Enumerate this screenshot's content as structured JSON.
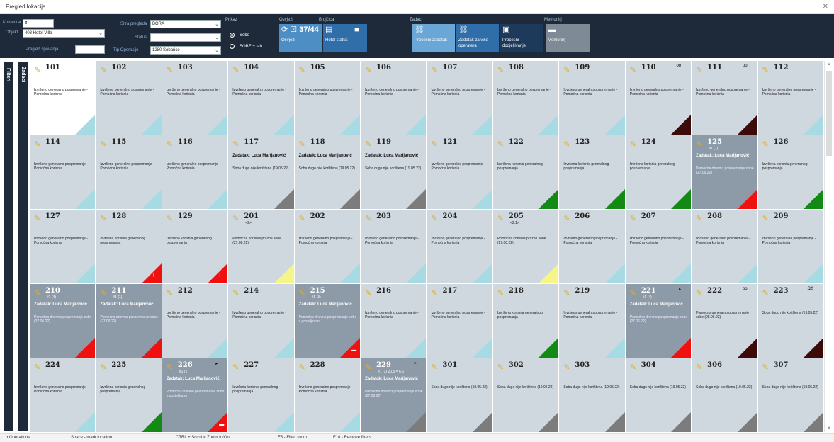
{
  "window": {
    "title": "Pregled lokacija",
    "close_glyph": "✕"
  },
  "toolbar": {
    "fields": {
      "komentar_label": "Komentar",
      "komentar_value": "ff",
      "objekt_label": "Objekt",
      "objekt_value": "408 Hotel Villa",
      "pregled_spavanja_label": "Pregled spavanja",
      "pregled_spavanja_value": "",
      "pregled_label": "Šifra pregleda",
      "pregled_value": "BORA",
      "status_label": "Status",
      "status_value": "",
      "tip_operacije_label": "Tip Operacije",
      "tip_operacije_value": "1280 Sobarice"
    },
    "prikaz": {
      "label": "Prikaz",
      "option1": "Sobe",
      "option2": "SOBE + tab."
    },
    "groups": {
      "osvjezi": "Osvježi",
      "brojcica": "Brojčica",
      "zadaci": "Zadaci",
      "mentalni": "Memonirj"
    },
    "buttons": {
      "osvjezi": "Osvježi",
      "counter": "37/44",
      "hotel_status": "Hotel status",
      "procesni_zadaci": "Procesni zadatak",
      "zadatak_za_vise": "Zadatak za više operatera",
      "procesni_dodjeljivanje": "Procesni dodjeljivanje",
      "memonirj": "Memonirj"
    }
  },
  "sidebar": {
    "label1": "Zadaci",
    "label2": "Filteri"
  },
  "colors": {
    "green": "#138a13",
    "red": "#f01010",
    "dark_red": "#3d0a0a",
    "grey": "#7c7c7c",
    "light_blue": "#a6dbe3",
    "yellow": "#f5f58a",
    "occupied": "#8d9aa7",
    "toolbar_bg": "#1e2a3a"
  },
  "rooms": [
    {
      "num": "101",
      "desc": "Izvršeno generalno pospremanje - Pomoćna korisnia",
      "tri": "#a6dbe3",
      "bg": "white"
    },
    {
      "num": "102",
      "desc": "Izvršeno generalno pospremanje - Pomoćna korisnia",
      "tri": "#a6dbe3"
    },
    {
      "num": "103",
      "desc": "Izvršeno generalno pospremanje - Pomoćna korisnia",
      "tri": "#a6dbe3"
    },
    {
      "num": "104",
      "desc": "Izvršeno generalno pospremanje - Pomoćna korisnia",
      "tri": "#a6dbe3"
    },
    {
      "num": "105",
      "desc": "Izvršeno generalno pospremanje - Pomoćna korisnia",
      "tri": "#a6dbe3"
    },
    {
      "num": "106",
      "desc": "Izvršeno generalno pospremanje - Pomoćna korisnia",
      "tri": "#a6dbe3"
    },
    {
      "num": "107",
      "desc": "Izvršeno generalno pospremanje - Pomoćna korisnia",
      "tri": "#a6dbe3"
    },
    {
      "num": "108",
      "desc": "Izvršeno generalno pospremanje - Pomoćna korisnia",
      "tri": "#a6dbe3"
    },
    {
      "num": "109",
      "desc": "Izvršeno generalno pospremanje - Pomoćna korisnia",
      "tri": "#a6dbe3"
    },
    {
      "num": "110",
      "gl": "oo",
      "desc": "Izvršeno generalno pospremanje - Pomoćna korisnia",
      "tri": "#3d0a0a"
    },
    {
      "num": "111",
      "gl": "oo",
      "desc": "Izvršeno generalno pospremanje - Pomoćna korisnia",
      "tri": "#3d0a0a"
    },
    {
      "num": "112",
      "desc": "Izvršeno generalno pospremanje - Pomoćna korisnia",
      "tri": "#a6dbe3"
    },
    {
      "num": "114",
      "desc": "Izvršeno generalno pospremanje - Pomoćna korisnia",
      "tri": "#a6dbe3"
    },
    {
      "num": "115",
      "desc": "Izvršeno generalno pospremanje - Pomoćna korisnia",
      "tri": "#a6dbe3"
    },
    {
      "num": "116",
      "desc": "Izvršeno generalno pospremanje - Pomoćna korisnia",
      "tri": "#a6dbe3"
    },
    {
      "num": "117",
      "bold": "Zadatak: Luca Marijanović",
      "desc": "Soba dugo nije korištena (19.05.22)",
      "tri": "#7c7c7c"
    },
    {
      "num": "118",
      "bold": "Zadatak: Luca Marijanović",
      "desc": "Soba dugo nije korištena (19.05.22)",
      "tri": "#7c7c7c"
    },
    {
      "num": "119",
      "bold": "Zadatak: Luca Marijanović",
      "desc": "Soba dugo nije korištena (19.05.22)",
      "tri": "#7c7c7c"
    },
    {
      "num": "121",
      "desc": "Izvršeno generalno pospremanje - Pomoćna korisnia",
      "tri": "#a6dbe3"
    },
    {
      "num": "122",
      "desc": "Izvršena korisnia generalnog pospremanja",
      "tri": "#138a13"
    },
    {
      "num": "123",
      "desc": "Izvršena korisnia generalnog pospremanja",
      "tri": "#138a13"
    },
    {
      "num": "124",
      "desc": "Izvršena korisnia generalnog pospremanja",
      "tri": "#138a13"
    },
    {
      "num": "125",
      "sub": "#1 (1)",
      "bold": "Zadatak: Luca Marijanović",
      "desc": "Pomoćna dnevno pospremanje sobe (27.06.22)",
      "tri": "#f01010",
      "bg": "occ"
    },
    {
      "num": "126",
      "desc": "Izvršena korisnia generalnog pospremanja",
      "tri": "#138a13"
    },
    {
      "num": "127",
      "desc": "Izvršeno generalno pospremanje - Pomoćna korisnia",
      "tri": "#a6dbe3"
    },
    {
      "num": "128",
      "desc": "Izvršena korisnia generalnog pospremanja",
      "tri": "#f01010",
      "mark": "!"
    },
    {
      "num": "129",
      "desc": "Izvršena korisnia generalnog pospremanja",
      "tri": "#f01010",
      "mark": "!"
    },
    {
      "num": "201",
      "sub": "<2>",
      "desc": "Pomoćna korisnia prazne sobe (27.06.22)",
      "tri": "#f5f58a"
    },
    {
      "num": "202",
      "desc": "Izvršeno generalno pospremanje - Pomoćna korisnia",
      "tri": "#a6dbe3"
    },
    {
      "num": "203",
      "desc": "Izvršeno generalno pospremanje - Pomoćna korisnia",
      "tri": "#a6dbe3"
    },
    {
      "num": "204",
      "desc": "Izvršeno generalno pospremanje - Pomoćna korisnia",
      "tri": "#a6dbe3"
    },
    {
      "num": "205",
      "sub": "<2.1>",
      "desc": "Pomoćna korisnia prazne sobe (27.06.22)",
      "tri": "#f5f58a"
    },
    {
      "num": "206",
      "desc": "Izvršeno generalno pospremanje - Pomoćna korisnia",
      "tri": "#a6dbe3"
    },
    {
      "num": "207",
      "desc": "Izvršeno generalno pospremanje - Pomoćna korisnia",
      "tri": "#a6dbe3"
    },
    {
      "num": "208",
      "desc": "Izvršeno generalno pospremanje - Pomoćna korisnia",
      "tri": "#a6dbe3"
    },
    {
      "num": "209",
      "desc": "Izvršeno generalno pospremanje - Pomoćna korisnia",
      "tri": "#a6dbe3"
    },
    {
      "num": "210",
      "sub": "#1 (4)",
      "bold": "Zadatak: Luca Marijanović",
      "desc": "Pomoćna dnevno pospremanje sobe (27.06.22)",
      "tri": "#f01010",
      "bg": "occ"
    },
    {
      "num": "211",
      "sub": "#1 (1)",
      "bold": "Zadatak: Luca Marijanović",
      "desc": "Pomoćna dnevno pospremanje sobe (27.06.22)",
      "tri": "#f01010",
      "bg": "occ"
    },
    {
      "num": "212",
      "desc": "Izvršeno generalno pospremanje - Pomoćna korisnia",
      "tri": "#a6dbe3"
    },
    {
      "num": "214",
      "desc": "Izvršeno generalno pospremanje - Pomoćna korisnia",
      "tri": "#a6dbe3"
    },
    {
      "num": "215",
      "sub": "#1 (3)",
      "bold": "Zadatak: Luca Marijanović",
      "desc": "Pomoćna dnevno pospremanje sobe s posteljinom",
      "tri": "#f01010",
      "bg": "occ",
      "mark": "▬"
    },
    {
      "num": "216",
      "desc": "Izvršeno generalno pospremanje - Pomoćna korisnia",
      "tri": "#a6dbe3"
    },
    {
      "num": "217",
      "desc": "Izvršeno generalno pospremanje - Pomoćna korisnia",
      "tri": "#a6dbe3"
    },
    {
      "num": "218",
      "desc": "Izvršena korisnia generalnog pospremanja",
      "tri": "#138a13"
    },
    {
      "num": "219",
      "desc": "Izvršeno generalno pospremanje - Pomoćna korisnia",
      "tri": "#a6dbe3"
    },
    {
      "num": "221",
      "sub": "#1 (4)",
      "gl": "▸",
      "bold": "Zadatak: Luca Marijanović",
      "desc": "Pomoćna dnevno pospremanje sobe (27.06.22)",
      "tri": "#f01010",
      "bg": "occ"
    },
    {
      "num": "222",
      "gl": "oo",
      "desc": "Pomoćno generalno pospremanje sobe (05.06.22)",
      "tri": "#3d0a0a"
    },
    {
      "num": "223",
      "gl": "ΩΔ",
      "desc": "Soba dugo nije korištena (19.05.22)",
      "tri": "#3d0a0a"
    },
    {
      "num": "224",
      "desc": "Izvršeno generalno pospremanje - Pomoćna korisnia",
      "tri": "#a6dbe3"
    },
    {
      "num": "225",
      "desc": "Izvršena korisnia generalnog pospremanja",
      "tri": "#138a13"
    },
    {
      "num": "226",
      "sub": "#1 (2)",
      "gl": "▸",
      "bold": "Zadatak: Luca Marijanović",
      "desc": "Pomoćna dnevno pospremanje sobe s posteljinom",
      "tri": "#f01010",
      "bg": "occ",
      "mark": "▬"
    },
    {
      "num": "227",
      "desc": "Izvršena korisnia generalnog pospremanja",
      "tri": "#a6dbe3"
    },
    {
      "num": "228",
      "desc": "Izvršeno generalno pospremanje - Pomoćna korisnia",
      "tri": "#a6dbe3"
    },
    {
      "num": "229",
      "sub": "#1 (2) 20.5 = 6.6",
      "gl": "⌂",
      "bold": "Zadatak: Luca Marijanović",
      "desc": "Pomoćna dnevno pospremanje sobe (27.06.22)",
      "tri": "#7c7c7c",
      "bg": "occ"
    },
    {
      "num": "301",
      "desc": "Soba dugo nije korištena (19.05.22)",
      "tri": "#7c7c7c"
    },
    {
      "num": "302",
      "desc": "Soba dugo nije korištena (19.05.22)",
      "tri": "#7c7c7c"
    },
    {
      "num": "303",
      "desc": "Soba dugo nije korištena (19.05.22)",
      "tri": "#7c7c7c"
    },
    {
      "num": "304",
      "desc": "Soba dugo nije korištena (19.05.22)",
      "tri": "#7c7c7c"
    },
    {
      "num": "306",
      "desc": "Soba dugo nije korištena (19.05.22)",
      "tri": "#7c7c7c"
    },
    {
      "num": "307",
      "desc": "Soba dugo nije korištena (19.05.22)",
      "tri": "#7c7c7c"
    }
  ],
  "statusbar": {
    "user": "mOperations",
    "hint1": "Space - mark location",
    "hint2": "CTRL + Scroll = Zoom In/Out",
    "hint3": "F5 - Filter room",
    "hint4": "F10 - Remove filters"
  }
}
